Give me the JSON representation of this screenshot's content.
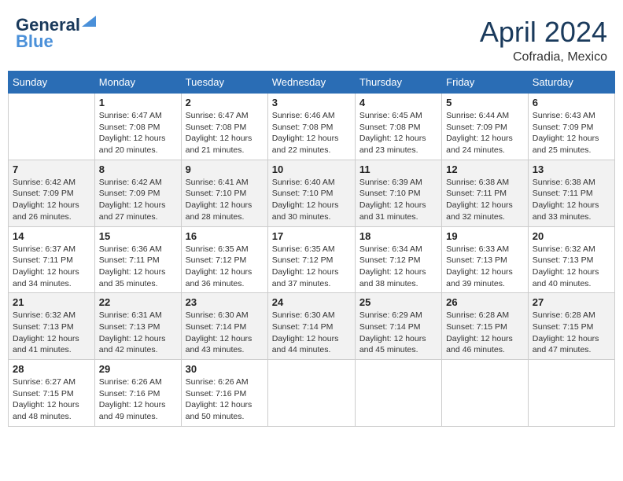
{
  "header": {
    "logo_line1": "General",
    "logo_line2": "Blue",
    "month_year": "April 2024",
    "location": "Cofradia, Mexico"
  },
  "days_of_week": [
    "Sunday",
    "Monday",
    "Tuesday",
    "Wednesday",
    "Thursday",
    "Friday",
    "Saturday"
  ],
  "weeks": [
    [
      {
        "day": "",
        "info": ""
      },
      {
        "day": "1",
        "info": "Sunrise: 6:47 AM\nSunset: 7:08 PM\nDaylight: 12 hours\nand 20 minutes."
      },
      {
        "day": "2",
        "info": "Sunrise: 6:47 AM\nSunset: 7:08 PM\nDaylight: 12 hours\nand 21 minutes."
      },
      {
        "day": "3",
        "info": "Sunrise: 6:46 AM\nSunset: 7:08 PM\nDaylight: 12 hours\nand 22 minutes."
      },
      {
        "day": "4",
        "info": "Sunrise: 6:45 AM\nSunset: 7:08 PM\nDaylight: 12 hours\nand 23 minutes."
      },
      {
        "day": "5",
        "info": "Sunrise: 6:44 AM\nSunset: 7:09 PM\nDaylight: 12 hours\nand 24 minutes."
      },
      {
        "day": "6",
        "info": "Sunrise: 6:43 AM\nSunset: 7:09 PM\nDaylight: 12 hours\nand 25 minutes."
      }
    ],
    [
      {
        "day": "7",
        "info": "Sunrise: 6:42 AM\nSunset: 7:09 PM\nDaylight: 12 hours\nand 26 minutes."
      },
      {
        "day": "8",
        "info": "Sunrise: 6:42 AM\nSunset: 7:09 PM\nDaylight: 12 hours\nand 27 minutes."
      },
      {
        "day": "9",
        "info": "Sunrise: 6:41 AM\nSunset: 7:10 PM\nDaylight: 12 hours\nand 28 minutes."
      },
      {
        "day": "10",
        "info": "Sunrise: 6:40 AM\nSunset: 7:10 PM\nDaylight: 12 hours\nand 30 minutes."
      },
      {
        "day": "11",
        "info": "Sunrise: 6:39 AM\nSunset: 7:10 PM\nDaylight: 12 hours\nand 31 minutes."
      },
      {
        "day": "12",
        "info": "Sunrise: 6:38 AM\nSunset: 7:11 PM\nDaylight: 12 hours\nand 32 minutes."
      },
      {
        "day": "13",
        "info": "Sunrise: 6:38 AM\nSunset: 7:11 PM\nDaylight: 12 hours\nand 33 minutes."
      }
    ],
    [
      {
        "day": "14",
        "info": "Sunrise: 6:37 AM\nSunset: 7:11 PM\nDaylight: 12 hours\nand 34 minutes."
      },
      {
        "day": "15",
        "info": "Sunrise: 6:36 AM\nSunset: 7:11 PM\nDaylight: 12 hours\nand 35 minutes."
      },
      {
        "day": "16",
        "info": "Sunrise: 6:35 AM\nSunset: 7:12 PM\nDaylight: 12 hours\nand 36 minutes."
      },
      {
        "day": "17",
        "info": "Sunrise: 6:35 AM\nSunset: 7:12 PM\nDaylight: 12 hours\nand 37 minutes."
      },
      {
        "day": "18",
        "info": "Sunrise: 6:34 AM\nSunset: 7:12 PM\nDaylight: 12 hours\nand 38 minutes."
      },
      {
        "day": "19",
        "info": "Sunrise: 6:33 AM\nSunset: 7:13 PM\nDaylight: 12 hours\nand 39 minutes."
      },
      {
        "day": "20",
        "info": "Sunrise: 6:32 AM\nSunset: 7:13 PM\nDaylight: 12 hours\nand 40 minutes."
      }
    ],
    [
      {
        "day": "21",
        "info": "Sunrise: 6:32 AM\nSunset: 7:13 PM\nDaylight: 12 hours\nand 41 minutes."
      },
      {
        "day": "22",
        "info": "Sunrise: 6:31 AM\nSunset: 7:13 PM\nDaylight: 12 hours\nand 42 minutes."
      },
      {
        "day": "23",
        "info": "Sunrise: 6:30 AM\nSunset: 7:14 PM\nDaylight: 12 hours\nand 43 minutes."
      },
      {
        "day": "24",
        "info": "Sunrise: 6:30 AM\nSunset: 7:14 PM\nDaylight: 12 hours\nand 44 minutes."
      },
      {
        "day": "25",
        "info": "Sunrise: 6:29 AM\nSunset: 7:14 PM\nDaylight: 12 hours\nand 45 minutes."
      },
      {
        "day": "26",
        "info": "Sunrise: 6:28 AM\nSunset: 7:15 PM\nDaylight: 12 hours\nand 46 minutes."
      },
      {
        "day": "27",
        "info": "Sunrise: 6:28 AM\nSunset: 7:15 PM\nDaylight: 12 hours\nand 47 minutes."
      }
    ],
    [
      {
        "day": "28",
        "info": "Sunrise: 6:27 AM\nSunset: 7:15 PM\nDaylight: 12 hours\nand 48 minutes."
      },
      {
        "day": "29",
        "info": "Sunrise: 6:26 AM\nSunset: 7:16 PM\nDaylight: 12 hours\nand 49 minutes."
      },
      {
        "day": "30",
        "info": "Sunrise: 6:26 AM\nSunset: 7:16 PM\nDaylight: 12 hours\nand 50 minutes."
      },
      {
        "day": "",
        "info": ""
      },
      {
        "day": "",
        "info": ""
      },
      {
        "day": "",
        "info": ""
      },
      {
        "day": "",
        "info": ""
      }
    ]
  ]
}
